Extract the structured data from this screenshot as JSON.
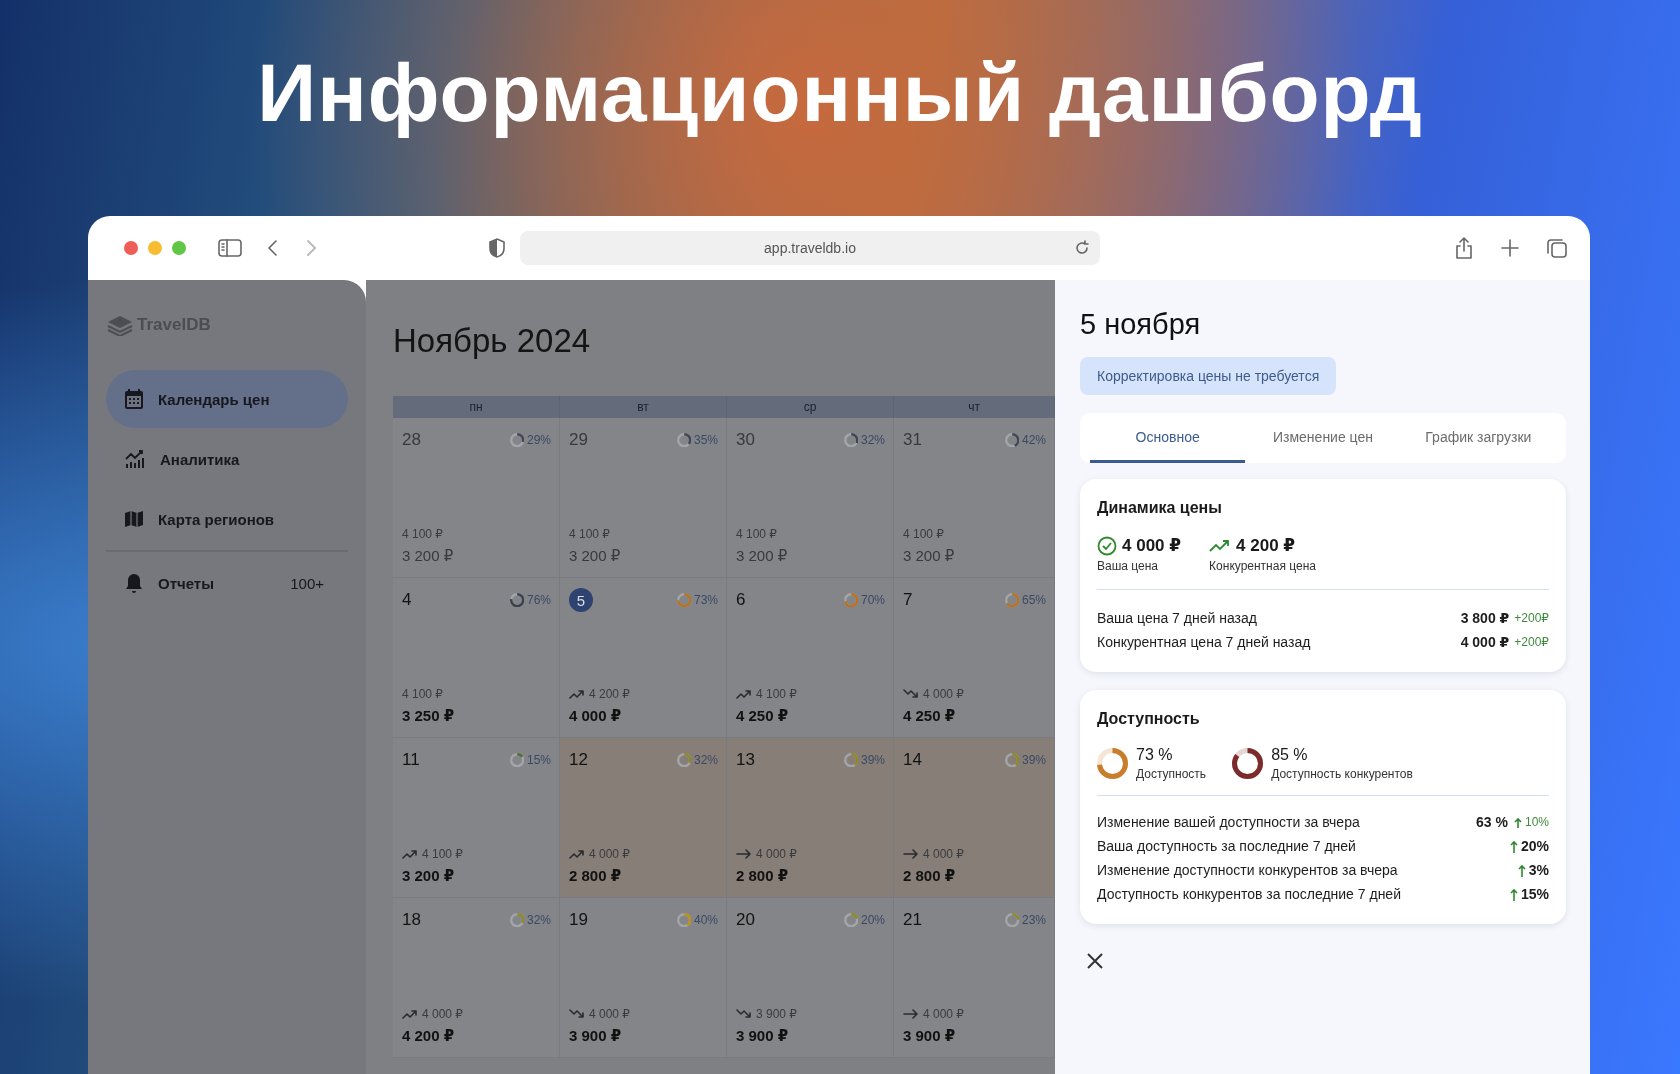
{
  "hero_title": "Информационный дашборд",
  "browser": {
    "url": "app.traveldb.io"
  },
  "sidebar": {
    "logo": "TravelDB",
    "items": [
      {
        "label": "Календарь цен",
        "selected": true
      },
      {
        "label": "Аналитика",
        "selected": false
      },
      {
        "label": "Карта регионов",
        "selected": false
      },
      {
        "label": "Отчеты",
        "badge": "100+",
        "selected": false
      }
    ]
  },
  "calendar": {
    "title": "Ноябрь 2024",
    "weekdays": [
      "пн",
      "вт",
      "ср",
      "чт"
    ],
    "weeks": [
      [
        {
          "day": "28",
          "percent": "29%",
          "level": 0.29,
          "color": "#3f4654",
          "past": true,
          "selected": false,
          "highlighted": false,
          "competitor_price": "4 100 ₽",
          "price": "3 200 ₽"
        },
        {
          "day": "29",
          "percent": "35%",
          "level": 0.35,
          "color": "#3f4654",
          "past": true,
          "selected": false,
          "highlighted": false,
          "competitor_price": "4 100 ₽",
          "price": "3 200 ₽"
        },
        {
          "day": "30",
          "percent": "32%",
          "level": 0.32,
          "color": "#3f4654",
          "past": true,
          "selected": false,
          "highlighted": false,
          "competitor_price": "4 100 ₽",
          "price": "3 200 ₽"
        },
        {
          "day": "31",
          "percent": "42%",
          "level": 0.42,
          "color": "#3f4654",
          "past": true,
          "selected": false,
          "highlighted": false,
          "competitor_price": "4 100 ₽",
          "price": "3 200 ₽"
        }
      ],
      [
        {
          "day": "4",
          "percent": "76%",
          "level": 0.76,
          "color": "#3a404c",
          "past": false,
          "selected": false,
          "highlighted": false,
          "competitor_price": "4 100 ₽",
          "price": "3 250 ₽"
        },
        {
          "day": "5",
          "percent": "73%",
          "level": 0.73,
          "color": "#b8731f",
          "past": false,
          "selected": true,
          "highlighted": false,
          "kind": "rising",
          "competitor_price": "4 200 ₽",
          "price": "4 000 ₽"
        },
        {
          "day": "6",
          "percent": "70%",
          "level": 0.7,
          "color": "#b8731f",
          "past": false,
          "selected": false,
          "highlighted": false,
          "kind": "rising",
          "competitor_price": "4 100 ₽",
          "price": "4 250 ₽"
        },
        {
          "day": "7",
          "percent": "65%",
          "level": 0.65,
          "color": "#b8731f",
          "past": false,
          "selected": false,
          "highlighted": false,
          "kind": "falling",
          "competitor_price": "4 000 ₽",
          "price": "4 250 ₽"
        }
      ],
      [
        {
          "day": "11",
          "percent": "15%",
          "level": 0.15,
          "color": "#4f6e33",
          "past": false,
          "selected": false,
          "highlighted": false,
          "kind": "rising",
          "competitor_price": "4 100 ₽",
          "price": "3 200 ₽"
        },
        {
          "day": "12",
          "percent": "32%",
          "level": 0.32,
          "color": "#8f8a24",
          "past": false,
          "selected": false,
          "highlighted": true,
          "kind": "rising",
          "competitor_price": "4 000 ₽",
          "price": "2 800 ₽"
        },
        {
          "day": "13",
          "percent": "39%",
          "level": 0.39,
          "color": "#8f8a24",
          "past": false,
          "selected": false,
          "highlighted": true,
          "kind": "flat",
          "competitor_price": "4 000 ₽",
          "price": "2 800 ₽"
        },
        {
          "day": "14",
          "percent": "39%",
          "level": 0.39,
          "color": "#8f8a24",
          "past": false,
          "selected": false,
          "highlighted": true,
          "kind": "flat",
          "competitor_price": "4 000 ₽",
          "price": "2 800 ₽"
        }
      ],
      [
        {
          "day": "18",
          "percent": "32%",
          "level": 0.32,
          "color": "#8f8a24",
          "past": false,
          "selected": false,
          "highlighted": false,
          "kind": "rising",
          "competitor_price": "4 000 ₽",
          "price": "4 200 ₽"
        },
        {
          "day": "19",
          "percent": "40%",
          "level": 0.4,
          "color": "#c0901a",
          "past": false,
          "selected": false,
          "highlighted": false,
          "kind": "falling",
          "competitor_price": "4 000 ₽",
          "price": "3 900 ₽"
        },
        {
          "day": "20",
          "percent": "20%",
          "level": 0.2,
          "color": "#8f8a24",
          "past": false,
          "selected": false,
          "highlighted": false,
          "kind": "falling",
          "competitor_price": "3 900 ₽",
          "price": "3 900 ₽"
        },
        {
          "day": "21",
          "percent": "23%",
          "level": 0.23,
          "color": "#8f8a24",
          "past": false,
          "selected": false,
          "highlighted": false,
          "kind": "flat",
          "competitor_price": "4 000 ₽",
          "price": "3 900 ₽"
        }
      ]
    ]
  },
  "detail": {
    "title": "5 ноября",
    "status": "Корректировка цены не требуется",
    "tabs": [
      {
        "label": "Основное",
        "selected": true
      },
      {
        "label": "Изменение цен",
        "selected": false
      },
      {
        "label": "График загрузки",
        "selected": false
      }
    ],
    "price_card": {
      "title": "Динамика цены",
      "your_price": {
        "value": "4 000 ₽",
        "label": "Ваша цена"
      },
      "competitor_price": {
        "value": "4 200 ₽",
        "label": "Конкурентная цена"
      },
      "rows": [
        {
          "label": "Ваша цена 7 дней назад",
          "value": "3 800 ₽",
          "change": "+200₽"
        },
        {
          "label": "Конкурентная цена 7 дней назад",
          "value": "4 000 ₽",
          "change": "+200₽"
        }
      ]
    },
    "availability_card": {
      "title": "Доступность",
      "gauges": [
        {
          "value": "73 %",
          "label": "Доступность",
          "level": 0.73,
          "color": "#c87d2a"
        },
        {
          "value": "85 %",
          "label": "Доступность конкурентов",
          "level": 0.85,
          "color": "#7c2b2b"
        }
      ],
      "rows": [
        {
          "kind": "value_change",
          "label": "Изменение вашей доступности за вчера",
          "value": "63 %",
          "change": "10%"
        },
        {
          "kind": "change",
          "label": "Ваша доступность за последние 7 дней",
          "change": "20%"
        },
        {
          "kind": "change",
          "label": "Изменение доступности конкурентов за вчера",
          "change": "3%"
        },
        {
          "kind": "change",
          "label": "Доступность конкурентов за последние 7 дней",
          "change": "15%"
        }
      ]
    }
  }
}
